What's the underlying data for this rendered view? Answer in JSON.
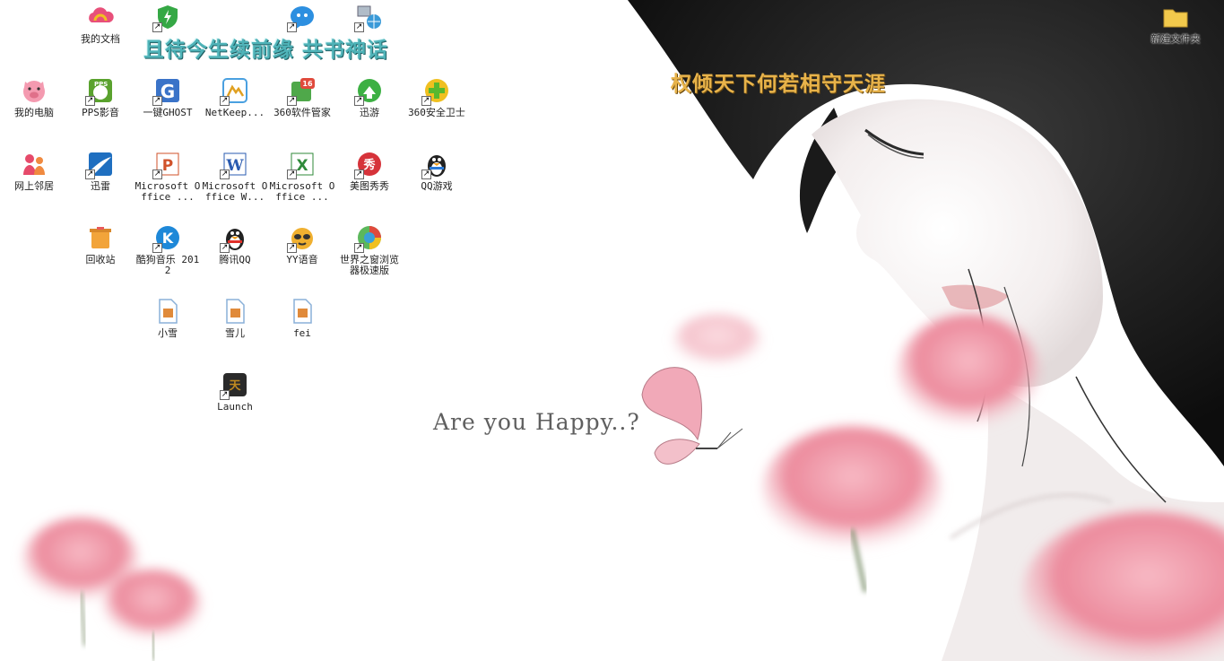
{
  "wallpaper": {
    "caption_line_1": "且待今生续前缘 共书神话",
    "caption_line_2": "权倾天下何若相守天涯",
    "caption_english": "Are you Happy..?",
    "colors": {
      "teal_text": "#4fb3b8",
      "gold_text": "#e8b34a",
      "petal": "#ee8f9f"
    }
  },
  "icons": [
    {
      "label": "我的文档",
      "icon": "colorful-cloud-icon",
      "color": "#e8507a"
    },
    {
      "label": "",
      "icon": "green-shield-icon",
      "color": "#35a845",
      "shortcut": true
    },
    {
      "label": "",
      "icon": "blue-bubble-icon",
      "color": "#2d8fe0",
      "shortcut": true
    },
    {
      "label": "",
      "icon": "network-globe-icon",
      "color": "#7a8aa0",
      "shortcut": true
    },
    {
      "label": "新建文件夹",
      "icon": "folder-icon",
      "color": "#f2c94c"
    },
    {
      "label": "我的电脑",
      "icon": "pink-pig-icon",
      "color": "#f49ab0"
    },
    {
      "label": "PPS影音",
      "icon": "pps-player-icon",
      "color": "#5aa22e",
      "shortcut": true
    },
    {
      "label": "一键GHOST",
      "icon": "ghost-g-icon",
      "color": "#3a73c8",
      "shortcut": true
    },
    {
      "label": "NetKeep...",
      "icon": "netkeeper-icon",
      "color": "#4aa0e0",
      "shortcut": true
    },
    {
      "label": "360软件管家",
      "icon": "software-manager-icon",
      "color": "#e04a3c",
      "shortcut": true
    },
    {
      "label": "迅游",
      "icon": "green-arrow-icon",
      "color": "#3cb043",
      "shortcut": true
    },
    {
      "label": "360安全卫士",
      "icon": "plus-shield-icon",
      "color": "#58b82f",
      "shortcut": true
    },
    {
      "label": "网上邻居",
      "icon": "people-icon",
      "color": "#e64a6a"
    },
    {
      "label": "迅雷",
      "icon": "thunder-bird-icon",
      "color": "#1f6fc0",
      "shortcut": true
    },
    {
      "label": "Microsoft Office ...",
      "icon": "powerpoint-icon",
      "color": "#d0522a",
      "shortcut": true
    },
    {
      "label": "Microsoft Office W...",
      "icon": "word-icon",
      "color": "#2a5bb0",
      "shortcut": true
    },
    {
      "label": "Microsoft Office ...",
      "icon": "excel-icon",
      "color": "#2f8a3a",
      "shortcut": true
    },
    {
      "label": "美图秀秀",
      "icon": "meitu-icon",
      "color": "#d6333a",
      "shortcut": true
    },
    {
      "label": "QQ游戏",
      "icon": "qq-game-icon",
      "color": "#f0a020",
      "shortcut": true
    },
    {
      "label": "回收站",
      "icon": "recycle-bin-icon",
      "color": "#f2a43a"
    },
    {
      "label": "酷狗音乐 2012",
      "icon": "kugou-icon",
      "color": "#1e88d8",
      "shortcut": true
    },
    {
      "label": "腾讯QQ",
      "icon": "penguin-icon",
      "color": "#222222",
      "shortcut": true
    },
    {
      "label": "YY语音",
      "icon": "yy-raccoon-icon",
      "color": "#f0b030",
      "shortcut": true
    },
    {
      "label": "世界之窗浏览器极速版",
      "icon": "browser-globe-icon",
      "color": "#3aa0d8",
      "shortcut": true
    },
    {
      "label": "小雪",
      "icon": "document-icon",
      "color": "#8ab0d8"
    },
    {
      "label": "雪儿",
      "icon": "document-icon",
      "color": "#8ab0d8"
    },
    {
      "label": "fei",
      "icon": "document-icon",
      "color": "#8ab0d8"
    },
    {
      "label": "Launch",
      "icon": "game-launch-icon",
      "color": "#c08a20",
      "shortcut": true
    }
  ]
}
